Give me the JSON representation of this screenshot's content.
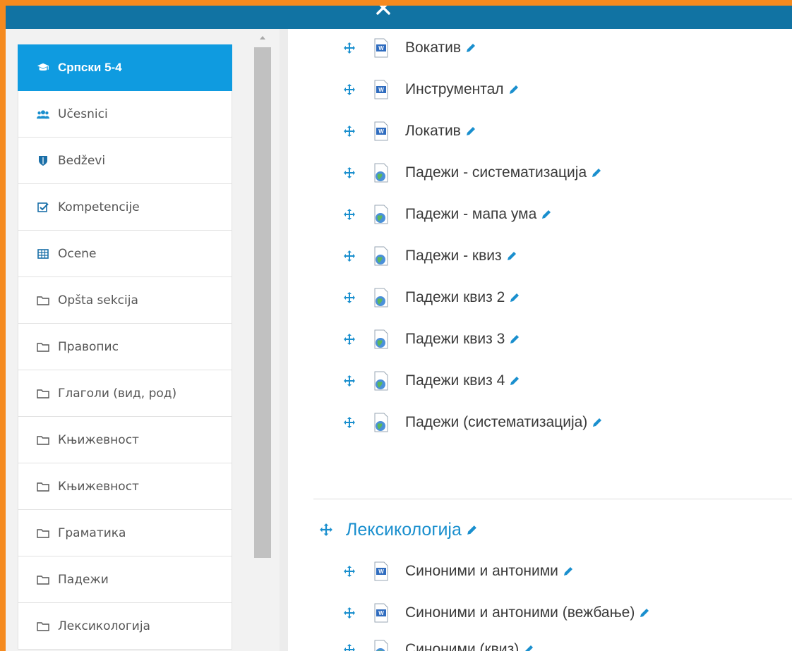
{
  "colors": {
    "frame": "#f58a1f",
    "topbar": "#1173a3",
    "accent": "#0f9be0",
    "link": "#1a8fce"
  },
  "topbar": {
    "close_icon": "close-x-icon"
  },
  "drawer": {
    "items": [
      {
        "label": "Српски 5-4",
        "icon": "graduation-cap-icon",
        "active": true
      },
      {
        "label": "Učesnici",
        "icon": "users-icon"
      },
      {
        "label": "Bedževi",
        "icon": "shield-icon"
      },
      {
        "label": "Kompetencije",
        "icon": "checkbox-icon"
      },
      {
        "label": "Ocene",
        "icon": "table-icon"
      },
      {
        "label": "Opšta sekcija",
        "icon": "folder-icon"
      },
      {
        "label": "Правопис",
        "icon": "folder-icon"
      },
      {
        "label": "Глаголи (вид, род)",
        "icon": "folder-icon"
      },
      {
        "label": "Књижевност",
        "icon": "folder-icon"
      },
      {
        "label": "Књижевност",
        "icon": "folder-icon"
      },
      {
        "label": "Граматика",
        "icon": "folder-icon"
      },
      {
        "label": "Падежи",
        "icon": "folder-icon"
      },
      {
        "label": "Лексикологија",
        "icon": "folder-icon"
      }
    ]
  },
  "main": {
    "activities": [
      {
        "label": "Вокатив",
        "type": "word-doc"
      },
      {
        "label": "Инструментал",
        "type": "word-doc"
      },
      {
        "label": "Локатив",
        "type": "word-doc"
      },
      {
        "label": "Падежи - систематизација",
        "type": "url"
      },
      {
        "label": "Падежи - мапа ума",
        "type": "url"
      },
      {
        "label": "Падежи - квиз",
        "type": "url"
      },
      {
        "label": "Падежи квиз 2",
        "type": "url"
      },
      {
        "label": "Падежи квиз 3",
        "type": "url"
      },
      {
        "label": "Падежи квиз 4",
        "type": "url"
      },
      {
        "label": "Падежи (систематизација)",
        "type": "url"
      }
    ],
    "section": {
      "title": "Лексикологија"
    },
    "section_activities": [
      {
        "label": "Синоними и антоними",
        "type": "word-doc"
      },
      {
        "label": "Синоними и антоними (вежбање)",
        "type": "word-doc"
      },
      {
        "label": "Синоними (квиз)",
        "type": "url"
      }
    ]
  }
}
